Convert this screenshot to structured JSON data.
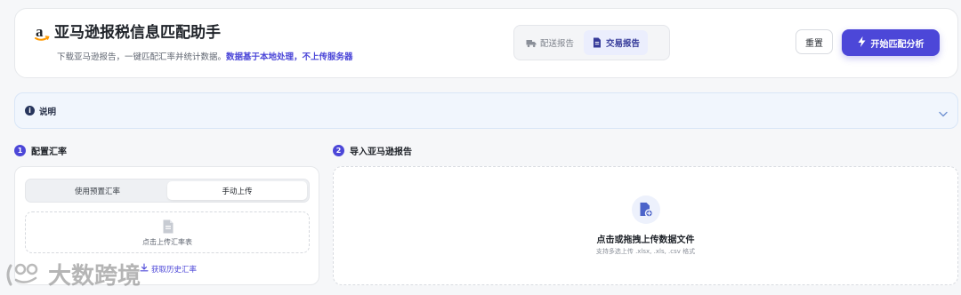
{
  "header": {
    "logo_icon": "amazon-a-icon",
    "title": "亚马逊报税信息匹配助手",
    "subtitle_prefix": "下载亚马逊报告，一键匹配汇率并统计数据。",
    "subtitle_highlight": "数据基于本地处理，不上传服务器",
    "tabs": [
      {
        "label": "配送报告",
        "icon": "truck-icon",
        "active": false
      },
      {
        "label": "交易报告",
        "icon": "document-icon",
        "active": true
      }
    ],
    "reset_label": "重置",
    "start_label": "开始匹配分析",
    "start_icon": "lightning-icon"
  },
  "info": {
    "label": "说明",
    "icon": "info-icon",
    "chevron": "chevron-down-icon"
  },
  "steps": [
    {
      "number": "1",
      "title": "配置汇率"
    },
    {
      "number": "2",
      "title": "导入亚马逊报告"
    }
  ],
  "rate_card": {
    "options": [
      {
        "label": "使用预置汇率",
        "active": false
      },
      {
        "label": "手动上传",
        "active": true
      }
    ],
    "upload_text": "点击上传汇率表",
    "history_link": "获取历史汇率"
  },
  "report_card": {
    "title": "点击或拖拽上传数据文件",
    "hint": "支持多选上传 .xlsx, .xls, .csv 格式"
  },
  "watermark": {
    "text": "大数跨境"
  },
  "colors": {
    "accent": "#4c47d8",
    "brand_orange": "#ff9900",
    "info_bg": "#f1f6fd"
  }
}
